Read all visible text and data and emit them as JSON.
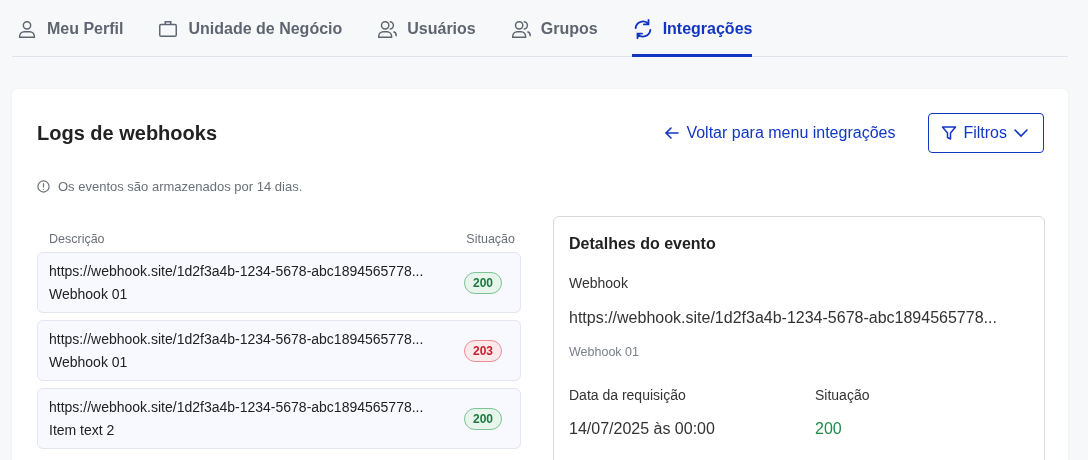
{
  "tabs": [
    {
      "label": "Meu Perfil",
      "kind": "person",
      "selected": false
    },
    {
      "label": "Unidade de Negócio",
      "kind": "briefcase",
      "selected": false
    },
    {
      "label": "Usuários",
      "kind": "people",
      "selected": false
    },
    {
      "label": "Grupos",
      "kind": "people",
      "selected": false
    },
    {
      "label": "Integrações",
      "kind": "sync",
      "selected": true
    }
  ],
  "page": {
    "title": "Logs de webhooks",
    "back_link": "Voltar para menu integrações",
    "filter_button": "Filtros",
    "notice": "Os eventos são armazenados por 14 dias."
  },
  "list": {
    "columns": [
      "Descrição",
      "Situação"
    ],
    "rows": [
      {
        "url": "https://webhook.site/1d2f3a4b-1234-5678-abc1894565778...",
        "name": "Webhook 01",
        "status": "200",
        "kind": "success"
      },
      {
        "url": "https://webhook.site/1d2f3a4b-1234-5678-abc1894565778...",
        "name": "Webhook 01",
        "status": "203",
        "kind": "error"
      },
      {
        "url": "https://webhook.site/1d2f3a4b-1234-5678-abc1894565778...",
        "name": "Item text 2",
        "status": "200",
        "kind": "success"
      }
    ]
  },
  "details": {
    "title": "Detalhes do evento",
    "webhook_label": "Webhook",
    "webhook_url": "https://webhook.site/1d2f3a4b-1234-5678-abc1894565778...",
    "webhook_name": "Webhook 01",
    "date_label": "Data da requisição",
    "date_value": "14/07/2025 às 00:00",
    "status": {
      "label": "Situação",
      "value": "200",
      "kind": "success"
    }
  }
}
